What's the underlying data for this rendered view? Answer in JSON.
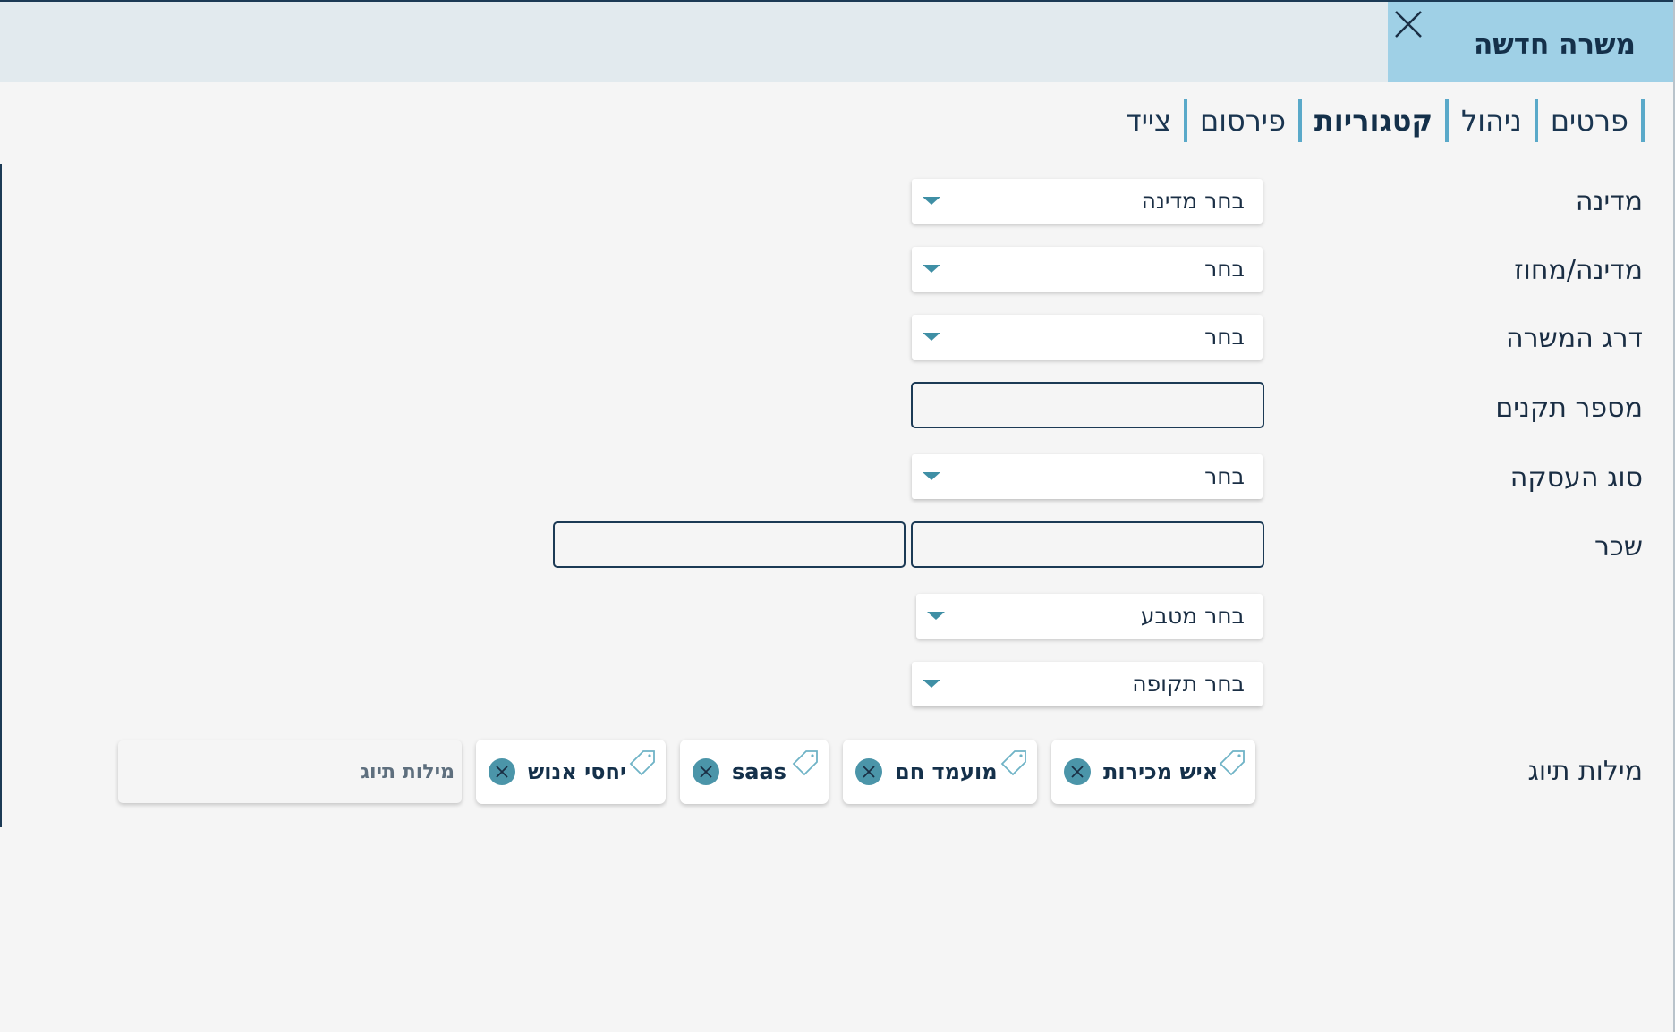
{
  "header": {
    "title": "משרה חדשה",
    "close_icon": "close-icon"
  },
  "tabs": [
    {
      "label": "פרטים",
      "active": false
    },
    {
      "label": "ניהול",
      "active": false
    },
    {
      "label": "קטגוריות",
      "active": true
    },
    {
      "label": "פירסום",
      "active": false
    },
    {
      "label": "צייד",
      "active": false
    }
  ],
  "form": {
    "country": {
      "label": "מדינה",
      "value": "בחר מדינה"
    },
    "state": {
      "label": "מדינה/מחוז",
      "value": "בחר"
    },
    "seniority": {
      "label": "דרג המשרה",
      "value": "בחר"
    },
    "positions": {
      "label": "מספר תקנים",
      "value": ""
    },
    "employment_type": {
      "label": "סוג העסקה",
      "value": "בחר"
    },
    "salary": {
      "label": "שכר",
      "from_value": "",
      "to_value": ""
    },
    "currency": {
      "value": "בחר מטבע"
    },
    "period": {
      "value": "בחר תקופה"
    },
    "tags": {
      "label": "מילות תיוג",
      "items": [
        "איש מכירות",
        "מועמד חם",
        "saas",
        "יחסי אנוש"
      ],
      "input_placeholder": "מילות תיוג",
      "tag_icon": "tag-icon",
      "remove_icon": "close-circle-icon"
    }
  },
  "colors": {
    "title_bg": "#9fd0e6",
    "header_bg": "#e2eaee",
    "accent": "#4b95a9",
    "text": "#14304a"
  }
}
